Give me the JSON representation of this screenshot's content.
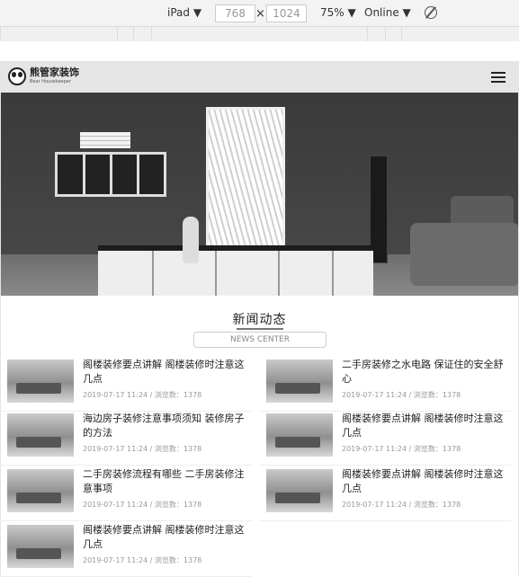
{
  "devtools": {
    "device": "iPad ▼",
    "width": "768",
    "height": "1024",
    "times": "×",
    "zoom": "75% ▼",
    "network": "Online ▼"
  },
  "site": {
    "brand": "熊管家装饰",
    "brand_en": "Bear Housekeeper"
  },
  "news": {
    "title": "新闻动态",
    "subtitle": "NEWS CENTER",
    "items": [
      {
        "title": "阁楼装修要点讲解 阁楼装修时注意这几点",
        "date": "2019-07-17 11:24",
        "views": "浏览数：1378"
      },
      {
        "title": "二手房装修之水电路 保证住的安全舒心",
        "date": "2019-07-17 11:24",
        "views": "浏览数：1378"
      },
      {
        "title": "海边房子装修注意事项须知 装修房子的方法",
        "date": "2019-07-17 11:24",
        "views": "浏览数：1378"
      },
      {
        "title": "阁楼装修要点讲解 阁楼装修时注意这几点",
        "date": "2019-07-17 11:24",
        "views": "浏览数：1378"
      },
      {
        "title": "二手房装修流程有哪些 二手房装修注意事项",
        "date": "2019-07-17 11:24",
        "views": "浏览数：1378"
      },
      {
        "title": "阁楼装修要点讲解 阁楼装修时注意这几点",
        "date": "2019-07-17 11:24",
        "views": "浏览数：1378"
      },
      {
        "title": "阁楼装修要点讲解 阁楼装修时注意这几点",
        "date": "2019-07-17 11:24",
        "views": "浏览数：1378"
      }
    ],
    "separator": "/"
  }
}
